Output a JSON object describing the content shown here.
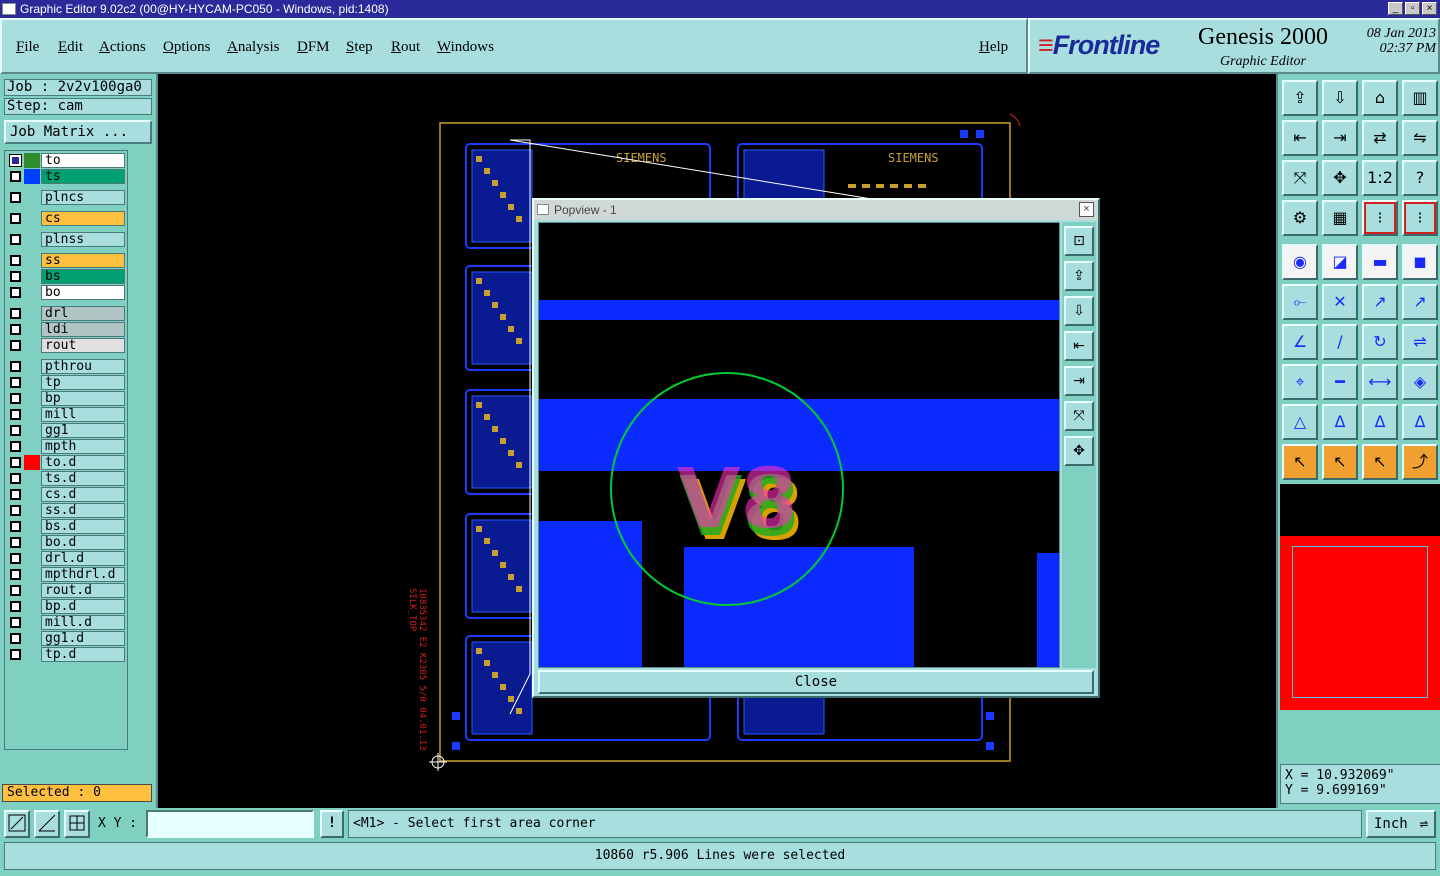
{
  "window": {
    "title": "Graphic Editor 9.02c2 (00@HY-HYCAM-PC050 - Windows, pid:1408)"
  },
  "menu": {
    "file": "File",
    "edit": "Edit",
    "actions": "Actions",
    "options": "Options",
    "analysis": "Analysis",
    "dfm": "DFM",
    "step": "Step",
    "rout": "Rout",
    "windows": "Windows",
    "help": "Help"
  },
  "brand": {
    "logo": "Frontline",
    "product": "Genesis 2000",
    "subtitle": "Graphic Editor",
    "date": "08 Jan 2013",
    "time": "02:37 PM"
  },
  "job": {
    "job_label": "Job : 2v2v100ga0",
    "step_label": "Step: cam",
    "matrix_button": "Job Matrix ..."
  },
  "layers": [
    {
      "name": "to",
      "swatch": "#2e8b2e",
      "bg": "#ffffff",
      "checked": true
    },
    {
      "name": "ts",
      "swatch": "#0040ff",
      "bg": "#00a070",
      "checked": false
    },
    {
      "name": "plncs",
      "swatch": "",
      "bg": "#a8dede",
      "checked": false
    },
    {
      "name": "cs",
      "swatch": "",
      "bg": "#ffc040",
      "checked": false
    },
    {
      "name": "plnss",
      "swatch": "",
      "bg": "#a8dede",
      "checked": false
    },
    {
      "name": "ss",
      "swatch": "",
      "bg": "#ffc040",
      "checked": false
    },
    {
      "name": "bs",
      "swatch": "",
      "bg": "#00a070",
      "checked": false
    },
    {
      "name": "bo",
      "swatch": "",
      "bg": "#ffffff",
      "checked": false
    },
    {
      "name": "drl",
      "swatch": "",
      "bg": "#b0c4c4",
      "checked": false
    },
    {
      "name": "ldi",
      "swatch": "",
      "bg": "#b0c4c4",
      "checked": false
    },
    {
      "name": "rout",
      "swatch": "",
      "bg": "#e0e0e0",
      "checked": false
    },
    {
      "name": "pthrou",
      "swatch": "",
      "bg": "#a8dede",
      "checked": false
    },
    {
      "name": "tp",
      "swatch": "",
      "bg": "#a8dede",
      "checked": false
    },
    {
      "name": "bp",
      "swatch": "",
      "bg": "#a8dede",
      "checked": false
    },
    {
      "name": "mill",
      "swatch": "",
      "bg": "#a8dede",
      "checked": false
    },
    {
      "name": "gg1",
      "swatch": "",
      "bg": "#a8dede",
      "checked": false
    },
    {
      "name": "mpth",
      "swatch": "",
      "bg": "#a8dede",
      "checked": false
    },
    {
      "name": "to.d",
      "swatch": "#ff0000",
      "bg": "#a8dede",
      "checked": false
    },
    {
      "name": "ts.d",
      "swatch": "",
      "bg": "#a8dede",
      "checked": false
    },
    {
      "name": "cs.d",
      "swatch": "",
      "bg": "#a8dede",
      "checked": false
    },
    {
      "name": "ss.d",
      "swatch": "",
      "bg": "#a8dede",
      "checked": false
    },
    {
      "name": "bs.d",
      "swatch": "",
      "bg": "#a8dede",
      "checked": false
    },
    {
      "name": "bo.d",
      "swatch": "",
      "bg": "#a8dede",
      "checked": false
    },
    {
      "name": "drl.d",
      "swatch": "",
      "bg": "#a8dede",
      "checked": false
    },
    {
      "name": "mpthdrl.d",
      "swatch": "",
      "bg": "#a8dede",
      "checked": false
    },
    {
      "name": "rout.d",
      "swatch": "",
      "bg": "#a8dede",
      "checked": false
    },
    {
      "name": "bp.d",
      "swatch": "",
      "bg": "#a8dede",
      "checked": false
    },
    {
      "name": "mill.d",
      "swatch": "",
      "bg": "#a8dede",
      "checked": false
    },
    {
      "name": "gg1.d",
      "swatch": "",
      "bg": "#a8dede",
      "checked": false
    },
    {
      "name": "tp.d",
      "swatch": "",
      "bg": "#a8dede",
      "checked": false
    }
  ],
  "selected": "Selected : 0",
  "board": {
    "label_siemens": "SIEMENS",
    "vertical_text": "10835342 E2 K2305 5/0 04.01.13",
    "vertical_text2": "SILK_TOP"
  },
  "popview": {
    "title": "Popview - 1",
    "text": "V8",
    "close": "Close"
  },
  "coords": {
    "x": "X = 10.932069\"",
    "y": "Y = 9.699169\""
  },
  "bottom": {
    "xy_label": "X Y :",
    "prompt": "<M1> - Select first area corner",
    "unit": "Inch",
    "status": "10860 r5.906 Lines were selected"
  },
  "tools_right": [
    "open-icon",
    "close-job-icon",
    "home-icon",
    "split-view-icon",
    "zoom-back-icon",
    "zoom-forward-icon",
    "layer-switch-icon",
    "snap-icon",
    "zoom-fit-icon",
    "zoom-center-icon",
    "zoom-1to1-icon",
    "help-icon",
    "measure-icon",
    "grid-icon",
    "layer-red-icon",
    "layer-red2-icon",
    "add-pad-icon",
    "select-profile-icon",
    "ruler-icon",
    "pad-select-icon",
    "move-nodes-icon",
    "delete-icon",
    "arc-icon",
    "resize-icon",
    "angle-icon",
    "line-icon",
    "rotate-icon",
    "mirror-icon",
    "copy-icon",
    "minus-icon",
    "dimension-icon",
    "shapes-icon",
    "triangle-icon",
    "poly-icon",
    "poly2-icon",
    "poly3-icon",
    "cursor-icon",
    "cursor-box-icon",
    "cursor-select-icon",
    "route-icon"
  ]
}
